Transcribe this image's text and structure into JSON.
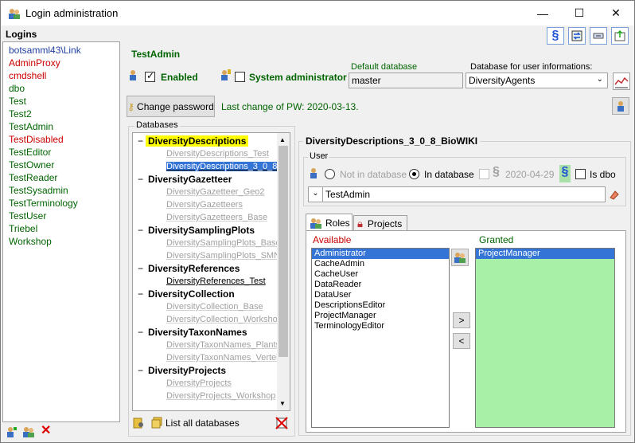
{
  "window": {
    "title": "Login administration",
    "minimize": "—",
    "maximize": "☐",
    "close": "✕"
  },
  "logins": {
    "header": "Logins",
    "items": [
      {
        "name": "botsamml43\\Link",
        "color": "#1f3f9f"
      },
      {
        "name": "AdminProxy",
        "color": "#cc0000"
      },
      {
        "name": "cmdshell",
        "color": "#cc0000"
      },
      {
        "name": "dbo",
        "color": "#006400"
      },
      {
        "name": "Test",
        "color": "#006400"
      },
      {
        "name": "Test2",
        "color": "#006400"
      },
      {
        "name": "TestAdmin",
        "color": "#006400"
      },
      {
        "name": "TestDisabled",
        "color": "#cc0000"
      },
      {
        "name": "TestEditor",
        "color": "#006400"
      },
      {
        "name": "TestOwner",
        "color": "#006400"
      },
      {
        "name": "TestReader",
        "color": "#006400"
      },
      {
        "name": "TestSysadmin",
        "color": "#006400"
      },
      {
        "name": "TestTerminology",
        "color": "#006400"
      },
      {
        "name": "TestUser",
        "color": "#006400"
      },
      {
        "name": "Triebel",
        "color": "#006400"
      },
      {
        "name": "Workshop",
        "color": "#006400"
      }
    ]
  },
  "login": {
    "name": "TestAdmin",
    "enabled_label": "Enabled",
    "enabled": true,
    "sysadmin_label": "System administrator",
    "sysadmin": false,
    "default_db_label": "Default database",
    "default_db_value": "master",
    "userinfo_db_label": "Database for user informations:",
    "userinfo_db_value": "DiversityAgents",
    "change_pw_label": "Change password",
    "last_change": "Last change of PW: 2020-03-13."
  },
  "databases": {
    "header": "Databases",
    "tree": [
      {
        "name": "DiversityDescriptions",
        "highlight": true,
        "subs": [
          {
            "name": "DiversityDescriptions_Test",
            "state": "grey"
          },
          {
            "name": "DiversityDescriptions_3_0_8_BioWIKI",
            "state": "selected"
          }
        ]
      },
      {
        "name": "DiversityGazetteer",
        "subs": [
          {
            "name": "DiversityGazetteer_Geo2",
            "state": "grey"
          },
          {
            "name": "DiversityGazetteers",
            "state": "grey"
          },
          {
            "name": "DiversityGazetteers_Base",
            "state": "grey"
          }
        ]
      },
      {
        "name": "DiversitySamplingPlots",
        "subs": [
          {
            "name": "DiversitySamplingPlots_Base",
            "state": "grey"
          },
          {
            "name": "DiversitySamplingPlots_SMNK",
            "state": "grey"
          }
        ]
      },
      {
        "name": "DiversityReferences",
        "subs": [
          {
            "name": "DiversityReferences_Test",
            "state": "normal"
          }
        ]
      },
      {
        "name": "DiversityCollection",
        "subs": [
          {
            "name": "DiversityCollection_Base",
            "state": "grey"
          },
          {
            "name": "DiversityCollection_Workshop",
            "state": "grey"
          }
        ]
      },
      {
        "name": "DiversityTaxonNames",
        "subs": [
          {
            "name": "DiversityTaxonNames_Plants",
            "state": "grey"
          },
          {
            "name": "DiversityTaxonNames_Vertebrates",
            "state": "grey"
          }
        ]
      },
      {
        "name": "DiversityProjects",
        "subs": [
          {
            "name": "DiversityProjects",
            "state": "grey"
          },
          {
            "name": "DiversityProjects_Workshop",
            "state": "grey"
          }
        ]
      }
    ],
    "list_all_label": "List all databases"
  },
  "detail": {
    "title": "DiversityDescriptions_3_0_8_BioWIKI",
    "user_group": "User",
    "not_in_db": "Not in database",
    "in_db": "In database",
    "date": "2020-04-29",
    "is_dbo": "Is dbo",
    "user_value": "TestAdmin",
    "tab_roles": "Roles",
    "tab_projects": "Projects",
    "available_label": "Available",
    "granted_label": "Granted",
    "available": [
      "Administrator",
      "CacheAdmin",
      "CacheUser",
      "DataReader",
      "DataUser",
      "DescriptionsEditor",
      "ProjectManager",
      "TerminologyEditor"
    ],
    "granted": [
      "ProjectManager"
    ],
    "add_btn": ">",
    "remove_btn": "<"
  }
}
